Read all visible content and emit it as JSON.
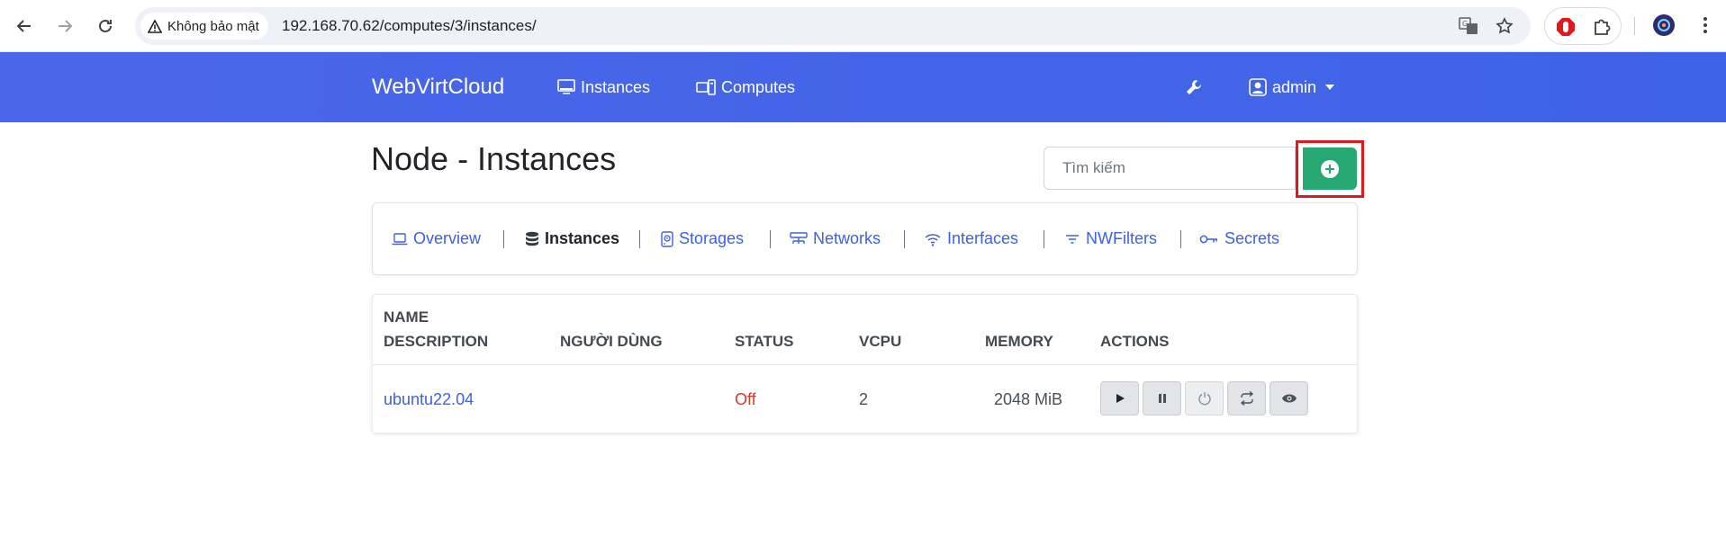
{
  "browser": {
    "security_label": "Không bảo mật",
    "url": "192.168.70.62/computes/3/instances/"
  },
  "navbar": {
    "brand": "WebVirtCloud",
    "links": [
      {
        "label": "Instances",
        "icon": "monitor-icon"
      },
      {
        "label": "Computes",
        "icon": "server-icon"
      }
    ],
    "settings_icon": "wrench-icon",
    "user_label": "admin"
  },
  "page": {
    "title": "Node - Instances",
    "search_placeholder": "Tìm kiếm",
    "add_icon": "plus-circle-icon"
  },
  "tabs": [
    {
      "label": "Overview",
      "icon": "laptop-icon",
      "active": false
    },
    {
      "label": "Instances",
      "icon": "database-icon",
      "active": true
    },
    {
      "label": "Storages",
      "icon": "disk-icon",
      "active": false
    },
    {
      "label": "Networks",
      "icon": "network-icon",
      "active": false
    },
    {
      "label": "Interfaces",
      "icon": "wifi-icon",
      "active": false
    },
    {
      "label": "NWFilters",
      "icon": "filter-icon",
      "active": false
    },
    {
      "label": "Secrets",
      "icon": "key-icon",
      "active": false
    }
  ],
  "table": {
    "headers": {
      "name": "NAME",
      "description": "DESCRIPTION",
      "user": "NGƯỜI DÙNG",
      "status": "STATUS",
      "vcpu": "VCPU",
      "memory": "MEMORY",
      "actions": "ACTIONS"
    },
    "rows": [
      {
        "name": "ubuntu22.04",
        "user": "",
        "status": "Off",
        "vcpu": "2",
        "memory": "2048 MiB"
      }
    ],
    "action_icons": [
      "play-icon",
      "pause-icon",
      "power-icon",
      "refresh-icon",
      "eye-icon"
    ]
  },
  "colors": {
    "navbar": "#4a66e8",
    "link": "#3d61e3",
    "add_button": "#27a872",
    "highlight": "#e0191e",
    "status_off": "#d33a2c"
  }
}
